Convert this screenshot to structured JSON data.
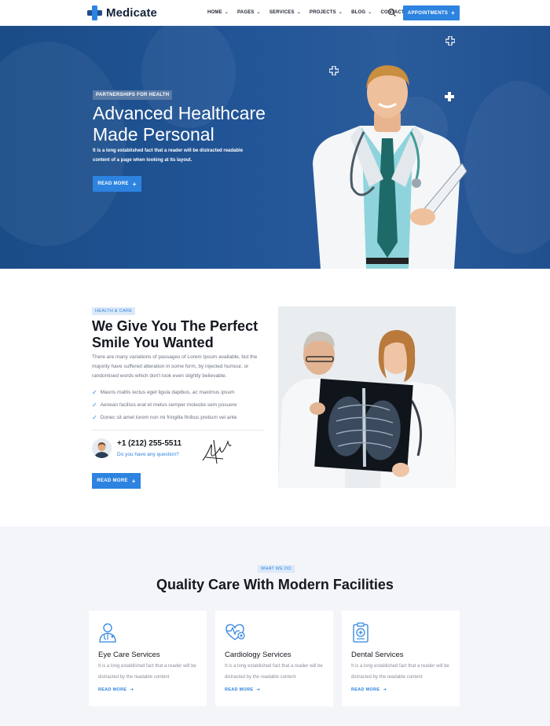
{
  "brand": {
    "name": "Medicate",
    "accent": "#2d83e0",
    "dark_blue": "#1f4f8f"
  },
  "nav": {
    "items": [
      {
        "label": "HOME",
        "has_dropdown": true
      },
      {
        "label": "PAGES",
        "has_dropdown": true
      },
      {
        "label": "SERVICES",
        "has_dropdown": true
      },
      {
        "label": "PROJECTS",
        "has_dropdown": true
      },
      {
        "label": "BLOG",
        "has_dropdown": true
      },
      {
        "label": "CONTACT US",
        "has_dropdown": false
      }
    ],
    "search_icon": "search-icon",
    "appointments_label": "APPOINTMENTS"
  },
  "hero": {
    "tag": "PARTNERSHIPS FOR HEALTH",
    "title": "Advanced Healthcare Made Personal",
    "description": "It is a long established fact that a reader will be distracted readable content of a page when looking at its layout.",
    "button_label": "READ MORE"
  },
  "about": {
    "tag": "HEALTH & CARE",
    "title": "We Give You The Perfect Smile You Wanted",
    "description": "There are many variations of passages of Lorem Ipsum available, but the majority have suffered alteration in some form, by injected humour, or randomised words which don't look even slightly believable.",
    "checklist": [
      "Mauris mattis lectus eget ligula dapibus, ac maximus ipsum",
      "Aenean facilisis erat et metus semper molestie sem posuere",
      "Donec sit amet lorem non mi fringilla finibus pretium vel ante"
    ],
    "phone": "+1 (212) 255-5511",
    "question": "Do you have any question?",
    "button_label": "READ MORE"
  },
  "services": {
    "tag": "WHAT WE DO",
    "title": "Quality Care With Modern Facilities",
    "cards": [
      {
        "icon": "doctor-icon",
        "name": "Eye Care Services",
        "description": "It is a long established fact that a reader will be distracted by the readable content",
        "link": "READ MORE"
      },
      {
        "icon": "heart-pulse-icon",
        "name": "Cardiology Services",
        "description": "It is a long established fact that a reader will be distracted by the readable content",
        "link": "READ MORE"
      },
      {
        "icon": "clipboard-medical-icon",
        "name": "Dental Services",
        "description": "It is a long established fact that a reader will be distracted by the readable content",
        "link": "READ MORE"
      }
    ]
  }
}
